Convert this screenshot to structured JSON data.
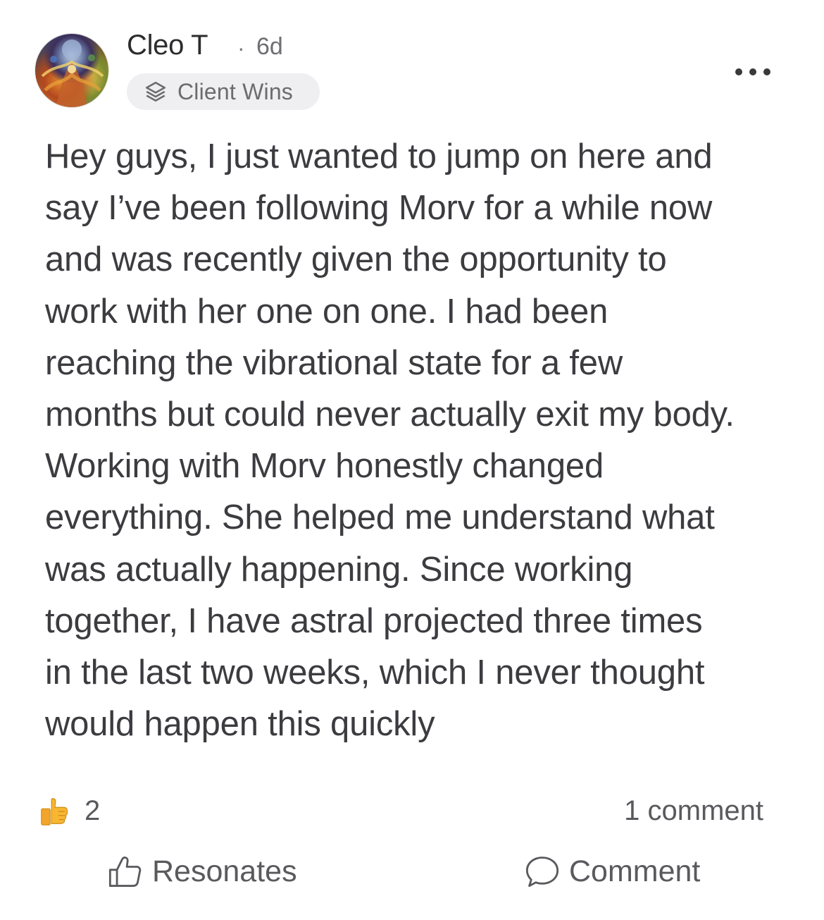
{
  "post": {
    "author": "Cleo T",
    "separator": "·",
    "time": "6d",
    "category": {
      "label": "Client Wins",
      "icon": "layers-icon"
    },
    "more_icon": "more-horizontal-icon",
    "body_lines": [
      "Hey guys, I just wanted to jump on here and",
      "say I’ve been following Morv for a while now",
      "and was recently given the opportunity to",
      "work with her one on one. I had been",
      "reaching the vibrational state for a few",
      "months but could never actually exit my body.",
      "Working with Morv honestly changed",
      "everything. She helped me understand what",
      "was actually happening. Since working",
      "together, I have astral projected three times",
      "in the last two weeks, which I never thought",
      "would happen this quickly"
    ]
  },
  "reactions": {
    "icon": "thumbs-up-emoji",
    "count": "2"
  },
  "comments": {
    "count_label": "1 comment"
  },
  "actions": {
    "resonates": {
      "label": "Resonates",
      "icon": "thumbs-up-outline-icon"
    },
    "comment": {
      "label": "Comment",
      "icon": "speech-bubble-icon"
    }
  },
  "colors": {
    "text": "#3c3c40",
    "muted": "#6e6e73",
    "badge_bg": "#efeff1",
    "emoji_yellow": "#f7b733"
  }
}
